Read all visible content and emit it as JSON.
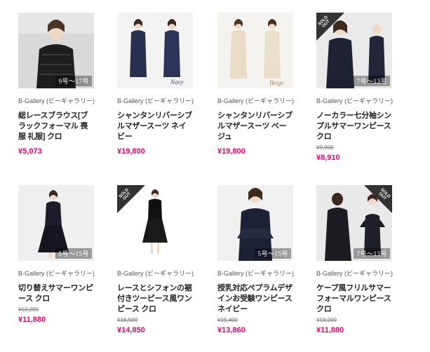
{
  "colors": {
    "price": "#e8006f",
    "sold_badge": "#333333",
    "text": "#222222"
  },
  "products": [
    {
      "brand": "B-Gallery (ビーギャラリー)",
      "name": "総レースブラウス[ブラックフォーマル 喪服 礼服] クロ",
      "price": "¥5,073",
      "image_overlay": "9号～17号"
    },
    {
      "brand": "B-Gallery (ビーギャラリー)",
      "name": "シャンタンリバーシブルマザースーツ ネイビー",
      "price": "¥19,800",
      "image_overlay": "Navy"
    },
    {
      "brand": "B-Gallery (ビーギャラリー)",
      "name": "シャンタンリバーシブルマザースーツ ベージュ",
      "price": "¥19,800",
      "image_overlay": "Beige"
    },
    {
      "brand": "B-Gallery (ビーギャラリー)",
      "name": "ノーカラー七分袖シンプルサマーワンピース クロ",
      "original_price": "¥9,900",
      "price": "¥8,910",
      "image_overlay": "7号～13号",
      "badge": "SOLD OUT"
    },
    {
      "brand": "B-Gallery (ビーギャラリー)",
      "name": "切り替えサマーワンピース クロ",
      "original_price": "¥13,200",
      "price": "¥11,880",
      "image_overlay": "5号～15号"
    },
    {
      "brand": "B-Gallery (ビーギャラリー)",
      "name": "レースとシフォンの裾付きツーピース風ワンピース クロ",
      "original_price": "¥16,500",
      "price": "¥14,850",
      "badge": "SOLD OUT"
    },
    {
      "brand": "B-Gallery (ビーギャラリー)",
      "name": "授乳対応ペプラムデザインお受験ワンピース ネイビー",
      "original_price": "¥15,400",
      "price": "¥13,860",
      "image_overlay": "5号～15号"
    },
    {
      "brand": "B-Gallery (ビーギャラリー)",
      "name": "ケープ風フリルサマーフォーマルワンピース クロ",
      "original_price": "¥13,200",
      "price": "¥11,880",
      "image_overlay": "7号～13号",
      "badge": "SOLD OUT"
    }
  ]
}
